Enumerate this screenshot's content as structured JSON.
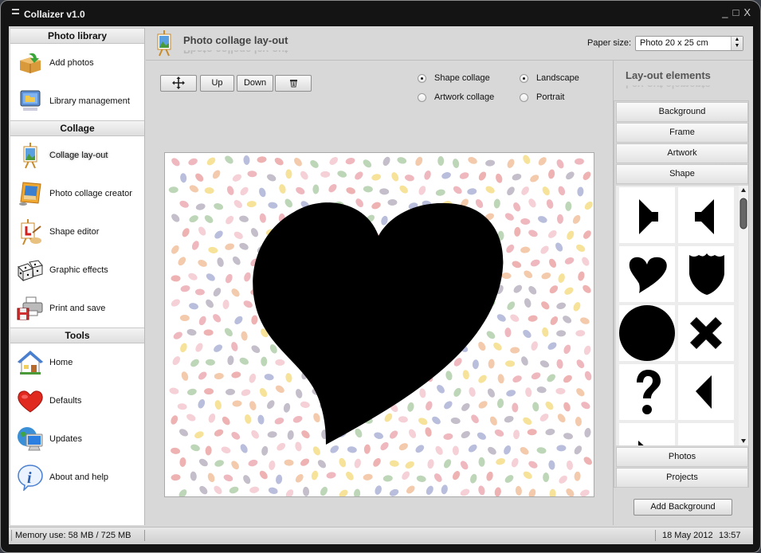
{
  "window": {
    "title": "Collaizer v1.0",
    "controls": {
      "minimize": "_",
      "maximize": "□",
      "close": "X"
    }
  },
  "sidebar": {
    "sections": [
      {
        "title": "Photo library",
        "items": [
          {
            "label": "Add photos",
            "icon": "box-add-icon"
          },
          {
            "label": "Library management",
            "icon": "monitor-folder-icon"
          }
        ]
      },
      {
        "title": "Collage",
        "items": [
          {
            "label": "Collage lay-out",
            "icon": "easel-icon",
            "active": true
          },
          {
            "label": "Photo collage creator",
            "icon": "picture-frame-icon"
          },
          {
            "label": "Shape editor",
            "icon": "easel-palette-icon"
          },
          {
            "label": "Graphic effects",
            "icon": "dice-icon"
          },
          {
            "label": "Print and save",
            "icon": "printer-floppy-icon"
          }
        ]
      },
      {
        "title": "Tools",
        "items": [
          {
            "label": "Home",
            "icon": "house-icon"
          },
          {
            "label": "Defaults",
            "icon": "heart-icon"
          },
          {
            "label": "Updates",
            "icon": "globe-monitor-icon"
          },
          {
            "label": "About and help",
            "icon": "info-bubble-icon"
          }
        ]
      }
    ]
  },
  "header": {
    "title": "Photo collage lay-out",
    "paper_size_label": "Paper size:",
    "paper_size_value": "Photo 20 x 25 cm"
  },
  "toolbar": {
    "move_icon": "move-arrows-icon",
    "up_label": "Up",
    "down_label": "Down",
    "delete_icon": "trash-icon"
  },
  "options": {
    "collage_type": [
      {
        "label": "Shape collage",
        "checked": true
      },
      {
        "label": "Artwork collage",
        "checked": false
      }
    ],
    "orientation": [
      {
        "label": "Landscape",
        "checked": true
      },
      {
        "label": "Portrait",
        "checked": false
      }
    ]
  },
  "canvas": {
    "background": "jellybeans-pattern",
    "shape": "heart"
  },
  "layout_elements": {
    "title": "Lay-out elements",
    "sections": [
      "Background",
      "Frame",
      "Artwork",
      "Shape",
      "Photos",
      "Projects"
    ],
    "shapes": [
      "speaker-right",
      "speaker-left",
      "heart",
      "shield",
      "circle",
      "cross",
      "question-mark",
      "triangle-left",
      "triangle-down-right",
      "triangle-up"
    ],
    "add_button": "Add Background"
  },
  "status": {
    "memory": "Memory use: 58 MB / 725 MB",
    "date": "18 May 2012",
    "time": "13:57"
  },
  "colors": {
    "window_frame": "#141414",
    "panel_bg": "#d8d8d8",
    "sidebar_bg": "#ffffff",
    "shape_fill": "#000000"
  }
}
